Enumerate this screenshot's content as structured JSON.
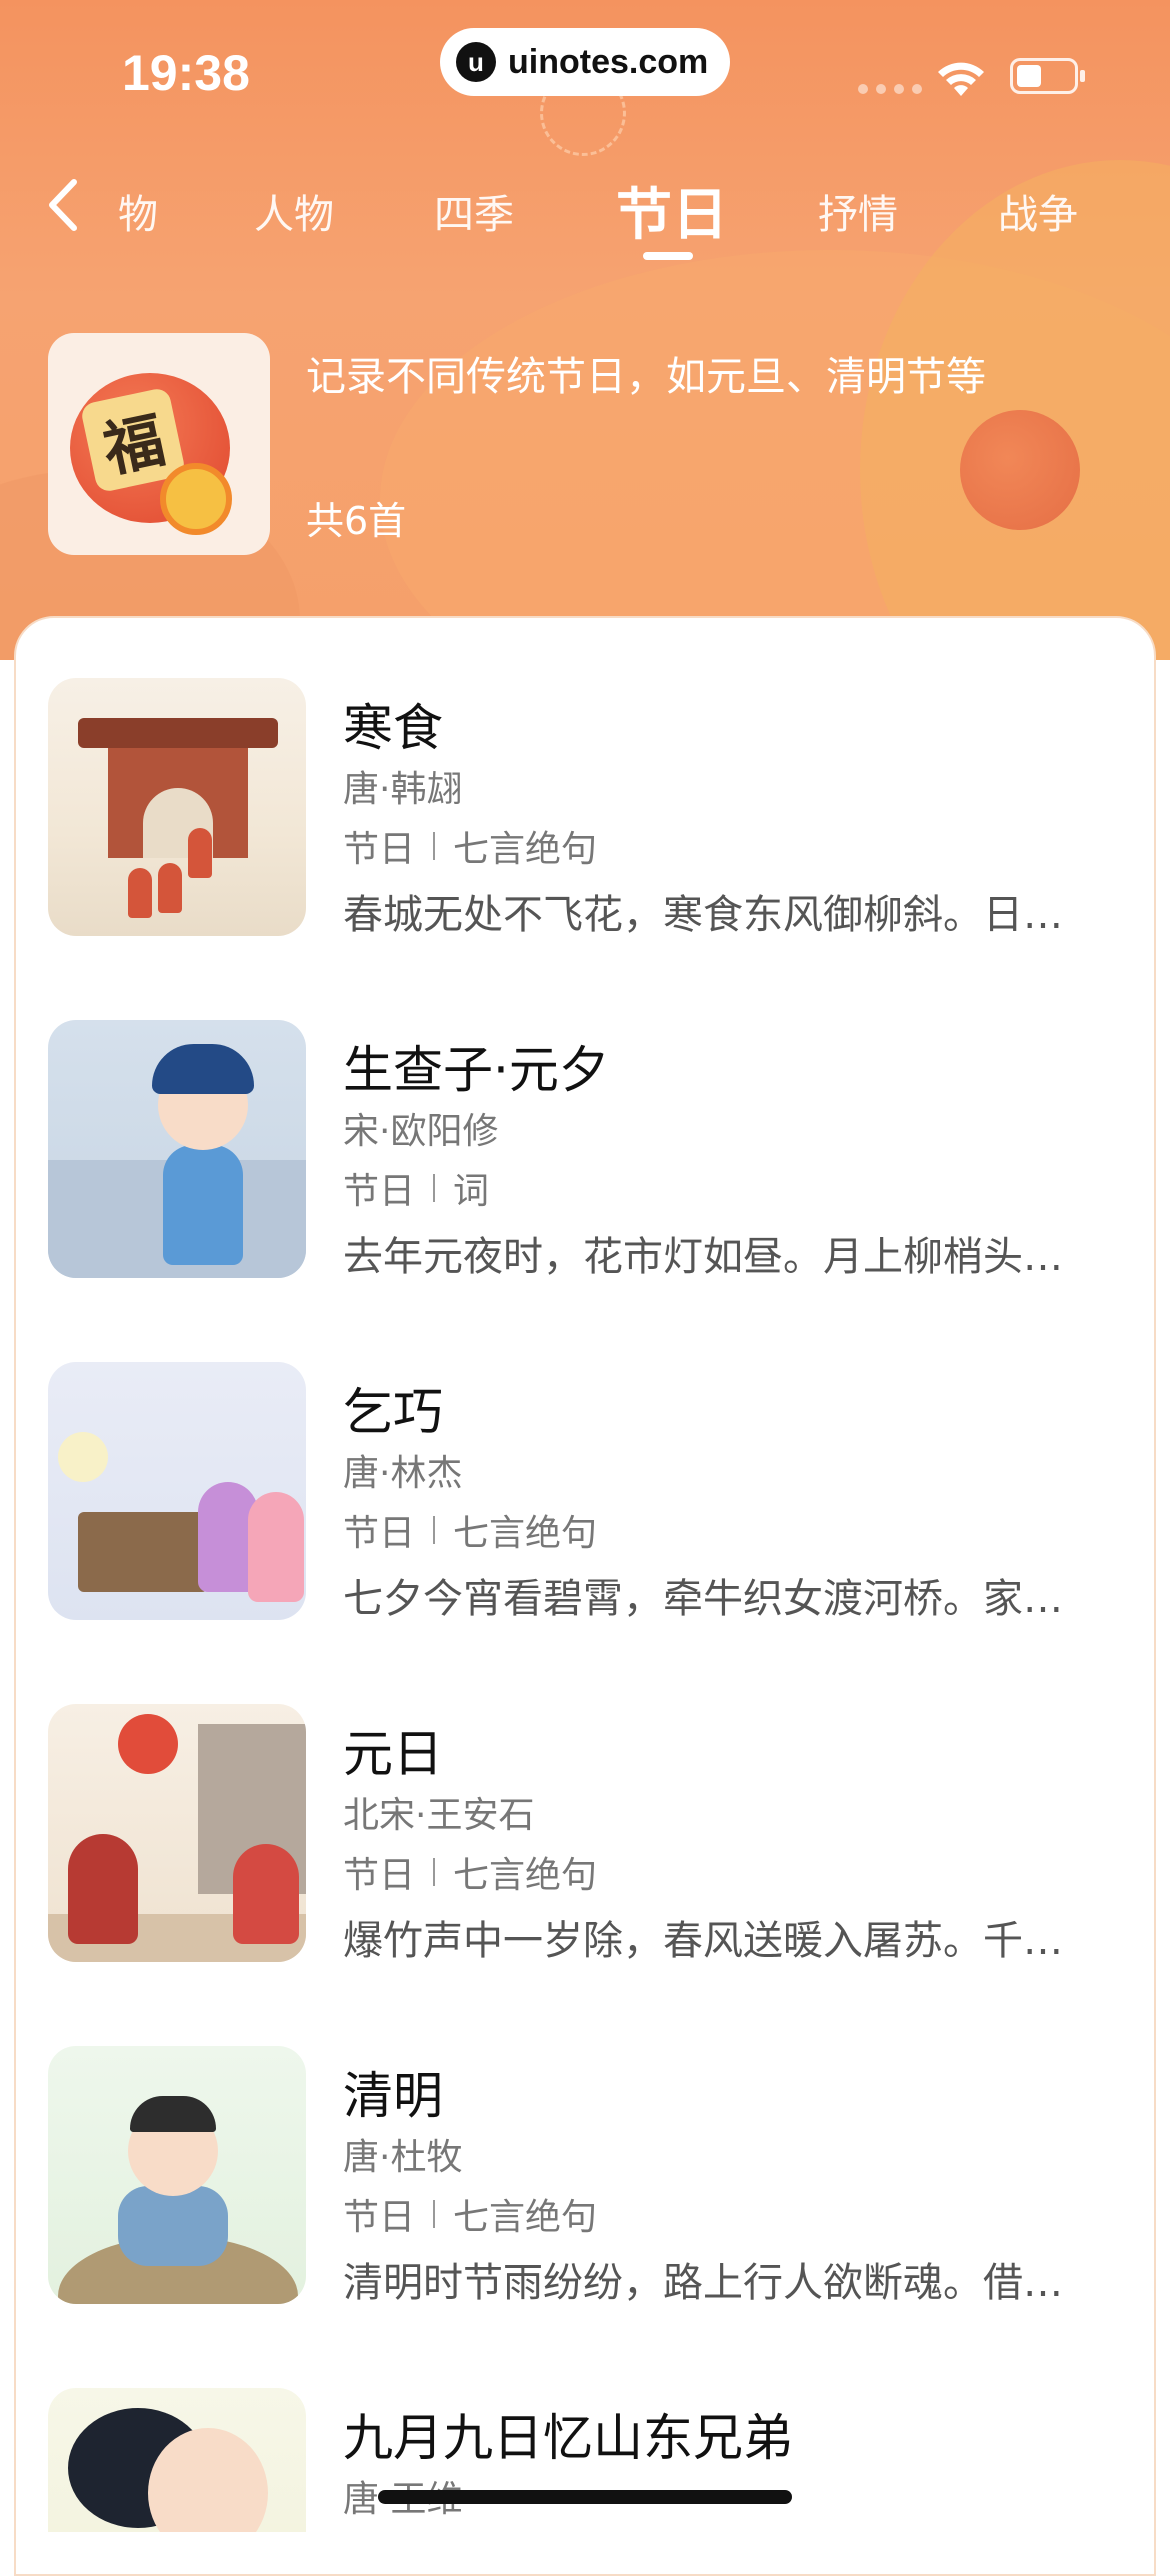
{
  "status_bar": {
    "time": "19:38",
    "watermark": "uinotes.com"
  },
  "nav": {
    "back_icon": "chevron-left-icon",
    "tabs": [
      {
        "label": "物"
      },
      {
        "label": "人物"
      },
      {
        "label": "四季"
      },
      {
        "label": "节日"
      },
      {
        "label": "抒情"
      },
      {
        "label": "战争"
      }
    ],
    "active_tab": "节日"
  },
  "category": {
    "description": "记录不同传统节日，如元旦、清明节等",
    "count": "共6首",
    "thumb_char": "福"
  },
  "poems": [
    {
      "title": "寒食",
      "author": "唐·韩翃",
      "tag": "节日",
      "form": "七言绝句",
      "excerpt": "春城无处不飞花，寒食东风御柳斜。日…"
    },
    {
      "title": "生查子·元夕",
      "author": "宋·欧阳修",
      "tag": "节日",
      "form": "词",
      "excerpt": "去年元夜时，花市灯如昼。月上柳梢头…"
    },
    {
      "title": "乞巧",
      "author": "唐·林杰",
      "tag": "节日",
      "form": "七言绝句",
      "excerpt": "七夕今宵看碧霄，牵牛织女渡河桥。家…"
    },
    {
      "title": "元日",
      "author": "北宋·王安石",
      "tag": "节日",
      "form": "七言绝句",
      "excerpt": "爆竹声中一岁除，春风送暖入屠苏。千…"
    },
    {
      "title": "清明",
      "author": "唐·杜牧",
      "tag": "节日",
      "form": "七言绝句",
      "excerpt": "清明时节雨纷纷，路上行人欲断魂。借…"
    },
    {
      "title": "九月九日忆山东兄弟",
      "author": "唐·王维",
      "tag": "",
      "form": "",
      "excerpt": ""
    }
  ],
  "colors": {
    "header_orange": "#f4935f",
    "title_text": "#111111",
    "meta_text": "#777777"
  }
}
